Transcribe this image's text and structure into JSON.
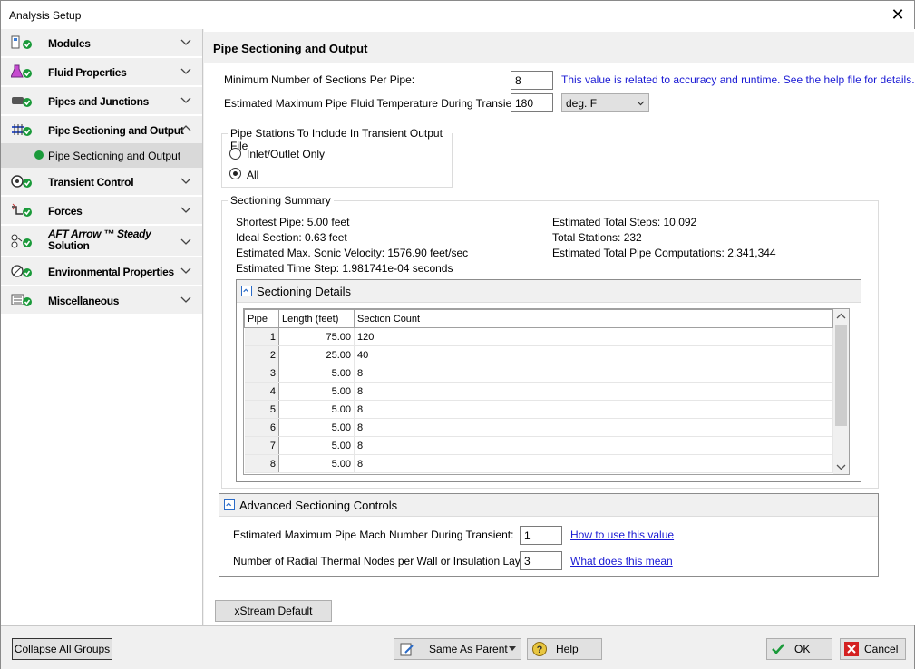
{
  "window": {
    "title": "Analysis Setup"
  },
  "sidebar": {
    "groups": [
      {
        "label": "Modules",
        "icon": "modules-icon"
      },
      {
        "label": "Fluid Properties",
        "icon": "flask-icon"
      },
      {
        "label": "Pipes and Junctions",
        "icon": "pipe-icon"
      },
      {
        "label": "Pipe Sectioning and Output",
        "icon": "sectioning-icon"
      },
      {
        "label": "Transient Control",
        "icon": "transient-icon"
      },
      {
        "label": "Forces",
        "icon": "forces-icon"
      },
      {
        "label": "AFT Arrow ™ Steady",
        "label2": "Solution",
        "icon": "arrow-steady-icon"
      },
      {
        "label": "Environmental Properties",
        "icon": "environment-icon"
      },
      {
        "label": "Miscellaneous",
        "icon": "misc-icon"
      }
    ],
    "subitem": "Pipe Sectioning and Output"
  },
  "main": {
    "title": "Pipe Sectioning and Output",
    "min_sections_label": "Minimum Number of Sections Per Pipe:",
    "min_sections_value": "8",
    "min_sections_hint": "This value is related to accuracy and runtime. See the help file for details.",
    "max_temp_label": "Estimated Maximum Pipe Fluid Temperature During Transient:",
    "max_temp_value": "180",
    "max_temp_unit": "deg. F",
    "stations": {
      "legend": "Pipe Stations To Include In Transient Output File",
      "opt1": "Inlet/Outlet Only",
      "opt2": "All"
    },
    "summary": {
      "legend": "Sectioning Summary",
      "shortest_pipe": "Shortest Pipe: 5.00 feet",
      "ideal_section": "Ideal Section: 0.63 feet",
      "max_sonic": "Estimated Max. Sonic Velocity: 1576.90 feet/sec",
      "time_step": "Estimated Time Step: 1.981741e-04 seconds",
      "total_steps": "Estimated Total Steps: 10,092",
      "total_stations": "Total Stations: 232",
      "total_computations": "Estimated Total Pipe Computations: 2,341,344"
    },
    "details": {
      "title": "Sectioning Details",
      "columns": [
        "Pipe",
        "Length (feet)",
        "Section Count"
      ],
      "rows": [
        [
          "1",
          "75.00",
          "120"
        ],
        [
          "2",
          "25.00",
          "40"
        ],
        [
          "3",
          "5.00",
          "8"
        ],
        [
          "4",
          "5.00",
          "8"
        ],
        [
          "5",
          "5.00",
          "8"
        ],
        [
          "6",
          "5.00",
          "8"
        ],
        [
          "7",
          "5.00",
          "8"
        ],
        [
          "8",
          "5.00",
          "8"
        ]
      ]
    },
    "advanced": {
      "title": "Advanced Sectioning Controls",
      "mach_label": "Estimated Maximum Pipe Mach Number During Transient:",
      "mach_value": "1",
      "mach_link": "How to use this value",
      "radial_label": "Number of Radial Thermal Nodes per Wall or Insulation Layer:",
      "radial_value": "3",
      "radial_link": "What does this mean"
    },
    "xstream_button": "xStream Default"
  },
  "footer": {
    "collapse": "Collapse All Groups",
    "same_as_parent": "Same As Parent",
    "help": "Help",
    "ok": "OK",
    "cancel": "Cancel"
  },
  "colors": {
    "check_green": "#1a9a3a",
    "link_blue": "#1a1ad4",
    "cancel_red": "#d42020"
  }
}
